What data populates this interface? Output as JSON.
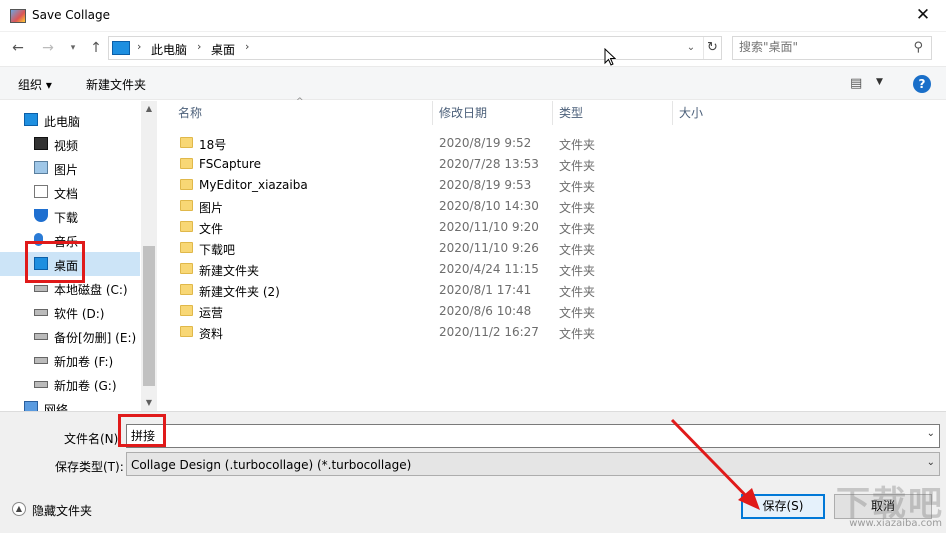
{
  "window": {
    "title": "Save Collage",
    "close_glyph": "✕"
  },
  "nav": {
    "back_glyph": "←",
    "forward_glyph": "→",
    "recent_glyph": "▾",
    "up_glyph": "↑",
    "crumbs": [
      "此电脑",
      "桌面"
    ],
    "crumb_sep": "›",
    "refresh_glyph": "↻",
    "dropdown_glyph": "⌄"
  },
  "search": {
    "placeholder": "搜索\"桌面\"",
    "icon": "search-icon"
  },
  "toolbar": {
    "organize_label": "组织 ▾",
    "new_folder_label": "新建文件夹",
    "view_glyph": "▤",
    "view_drop": "▼",
    "help_label": "?"
  },
  "sidebar": {
    "items": [
      {
        "label": "此电脑",
        "icon": "pc-icon",
        "level": 0
      },
      {
        "label": "视频",
        "icon": "video-icon",
        "level": 1
      },
      {
        "label": "图片",
        "icon": "pictures-icon",
        "level": 1
      },
      {
        "label": "文档",
        "icon": "documents-icon",
        "level": 1
      },
      {
        "label": "下载",
        "icon": "download-icon",
        "level": 1
      },
      {
        "label": "音乐",
        "icon": "music-icon",
        "level": 1
      },
      {
        "label": "桌面",
        "icon": "desktop-icon",
        "level": 1,
        "selected": true
      },
      {
        "label": "本地磁盘 (C:)",
        "icon": "drive-icon",
        "level": 1
      },
      {
        "label": "软件 (D:)",
        "icon": "drive-icon",
        "level": 1
      },
      {
        "label": "备份[勿删] (E:)",
        "icon": "drive-icon",
        "level": 1
      },
      {
        "label": "新加卷 (F:)",
        "icon": "drive-icon",
        "level": 1
      },
      {
        "label": "新加卷 (G:)",
        "icon": "drive-icon",
        "level": 1
      },
      {
        "label": "网络",
        "icon": "network-icon",
        "level": 0
      }
    ],
    "scroll_up": "▲",
    "scroll_down": "▼"
  },
  "columns": {
    "name": "名称",
    "date": "修改日期",
    "type": "类型",
    "size": "大小",
    "sort_glyph": "^"
  },
  "files": [
    {
      "name": "18号",
      "date": "2020/8/19 9:52",
      "type": "文件夹"
    },
    {
      "name": "FSCapture",
      "date": "2020/7/28 13:53",
      "type": "文件夹"
    },
    {
      "name": "MyEditor_xiazaiba",
      "date": "2020/8/19 9:53",
      "type": "文件夹"
    },
    {
      "name": "图片",
      "date": "2020/8/10 14:30",
      "type": "文件夹"
    },
    {
      "name": "文件",
      "date": "2020/11/10 9:20",
      "type": "文件夹"
    },
    {
      "name": "下载吧",
      "date": "2020/11/10 9:26",
      "type": "文件夹"
    },
    {
      "name": "新建文件夹",
      "date": "2020/4/24 11:15",
      "type": "文件夹"
    },
    {
      "name": "新建文件夹 (2)",
      "date": "2020/8/1 17:41",
      "type": "文件夹"
    },
    {
      "name": "运营",
      "date": "2020/8/6 10:48",
      "type": "文件夹"
    },
    {
      "name": "资料",
      "date": "2020/11/2 16:27",
      "type": "文件夹"
    }
  ],
  "form": {
    "filename_label": "文件名(N):",
    "filename_value": "拼接",
    "filetype_label": "保存类型(T):",
    "filetype_value": "Collage Design (.turbocollage) (*.turbocollage)",
    "dropdown_glyph": "⌄",
    "hide_folders_label": "隐藏文件夹",
    "hide_folders_glyph": "▲",
    "save_label": "保存(S)",
    "cancel_label": "取消"
  },
  "watermark": {
    "logo": "下载吧",
    "site": "www.xiazaiba.com"
  },
  "colors": {
    "accent": "#0078d7",
    "annotation": "#e01a1a",
    "selection": "#cce4f7",
    "folder": "#f8d775"
  }
}
